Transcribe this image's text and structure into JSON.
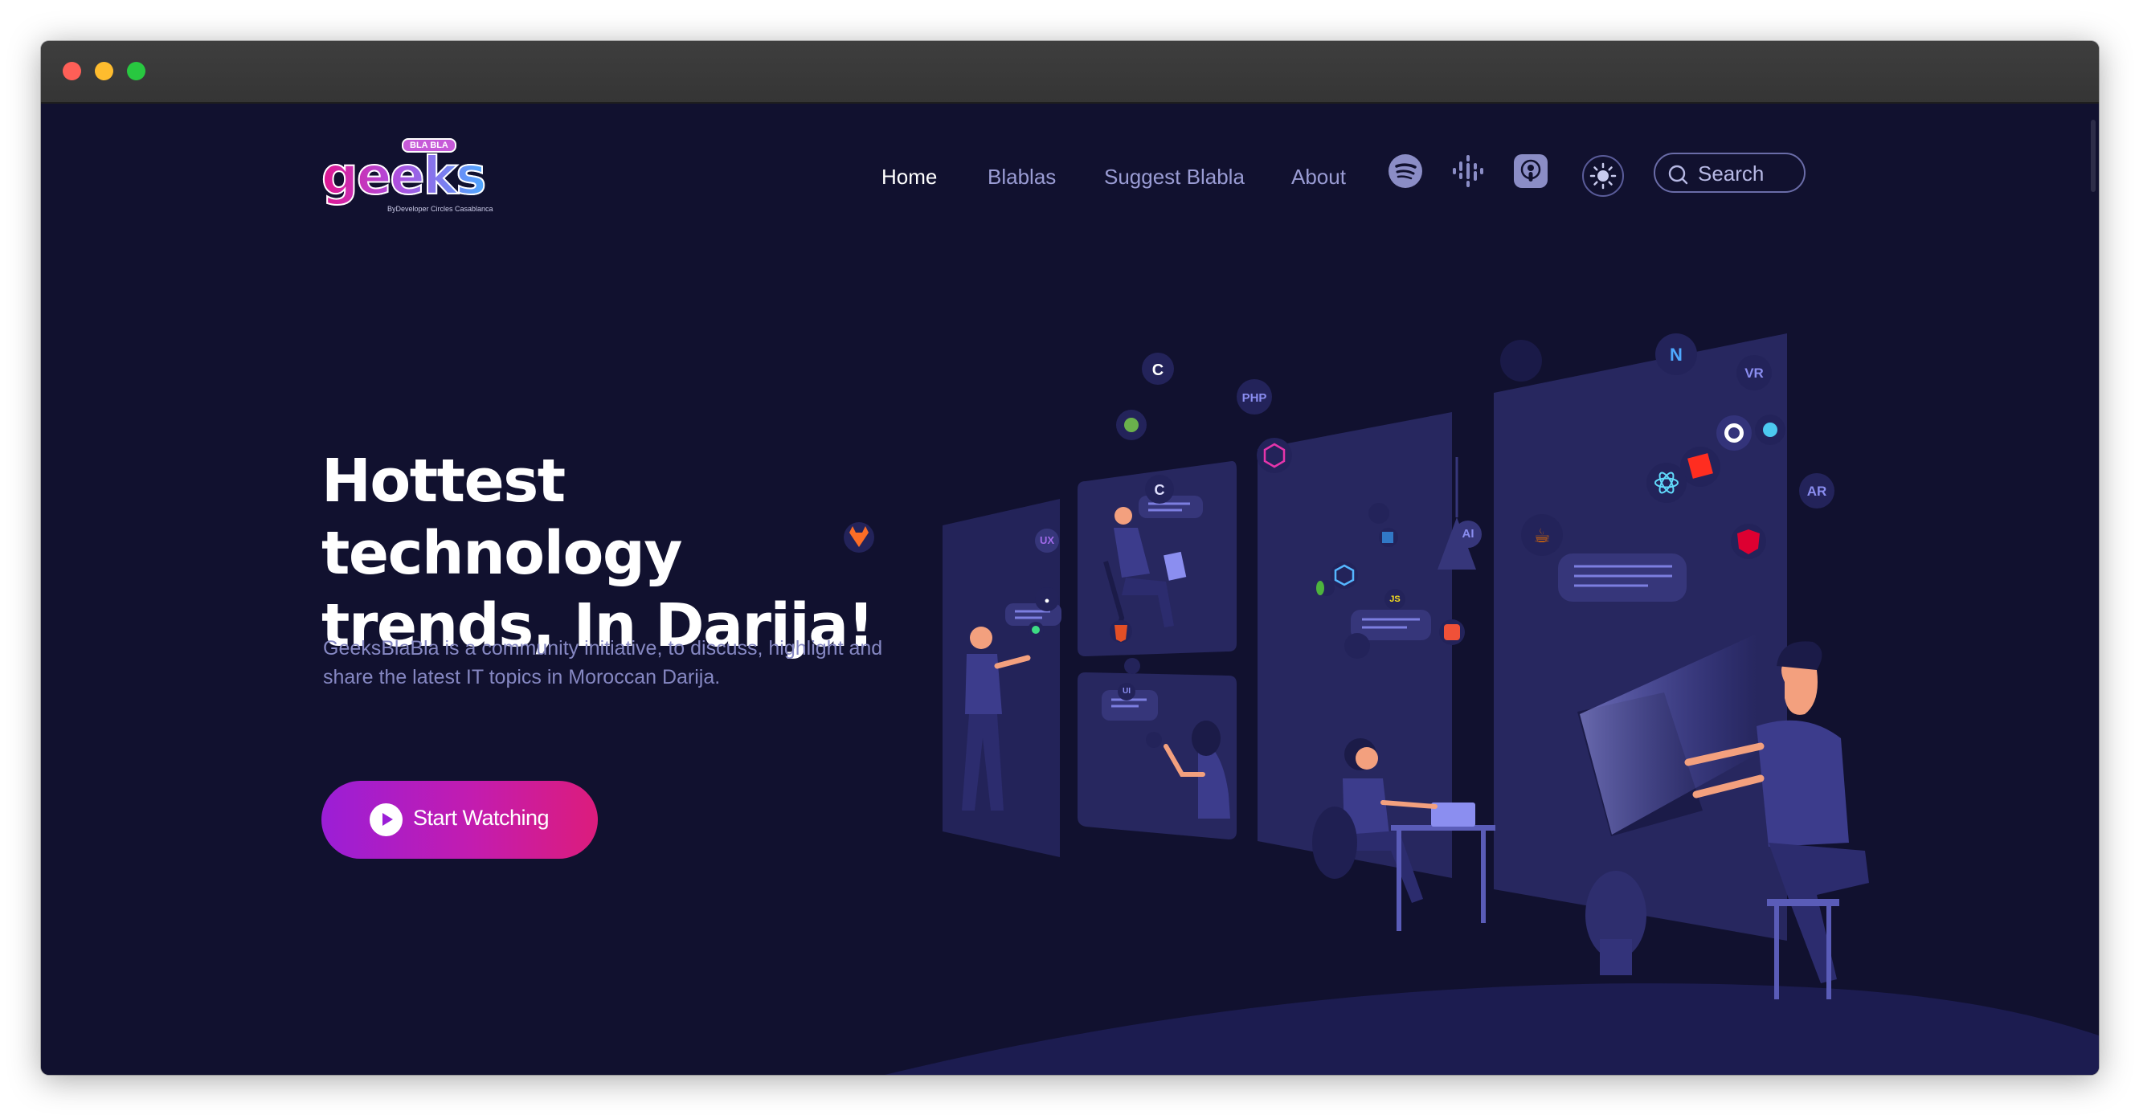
{
  "browser": {
    "controls": [
      "close",
      "minimize",
      "zoom"
    ]
  },
  "header": {
    "logo": {
      "word": "geeks",
      "badge": "BLA BLA",
      "tagline": "ByDeveloper Circles Casablanca"
    },
    "nav": [
      {
        "label": "Home",
        "active": true
      },
      {
        "label": "Blablas",
        "active": false
      },
      {
        "label": "Suggest Blabla",
        "active": false
      },
      {
        "label": "About",
        "active": false
      }
    ],
    "social_icons": [
      "spotify-icon",
      "google-podcasts-icon",
      "apple-podcasts-icon"
    ],
    "theme_toggle_icon": "sun-icon",
    "search": {
      "placeholder": "Search",
      "icon": "search-icon"
    }
  },
  "hero": {
    "title_line1": "Hottest technology",
    "title_line2": "trends, In Darija!",
    "description": "GeeksBlaBla is a community initiative, to discuss, highlight and share the latest IT topics in Moroccan Darija.",
    "cta": {
      "label": "Start Watching",
      "icon": "play-icon"
    }
  },
  "illustration": {
    "badges": [
      "C",
      "PHP",
      "UX",
      "AI",
      "TS",
      "JS",
      "VR",
      "AR",
      "UI"
    ],
    "tech_icons": [
      "c-icon",
      "php-icon",
      "spring-icon",
      "graphql-icon",
      "gitlab-icon",
      "java-icon",
      "nativescript-icon",
      "github-icon",
      "react-icon",
      "laravel-icon",
      "angular-icon",
      "html5-icon",
      "swift-icon",
      "android-icon",
      "node-icon",
      "vue-icon",
      "mongodb-icon"
    ]
  },
  "colors": {
    "background": "#11112f",
    "panel": "#27275f",
    "nav_text": "#9a9cd4",
    "cta_start": "#9b1ed6",
    "cta_end": "#dc1c7c",
    "accent": "#6d6fe0"
  }
}
